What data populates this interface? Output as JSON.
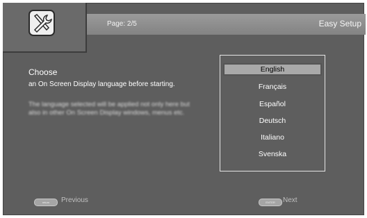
{
  "header": {
    "page_indicator": "Page: 2/5",
    "title": "Easy Setup",
    "icon": "wrench-tool-icon"
  },
  "main": {
    "heading": "Choose",
    "description": "an On Screen Display language before starting.",
    "note": "The language selected will be applied not only here but also in other On Screen Display windows, menus etc."
  },
  "languages": {
    "selected_index": 0,
    "items": [
      "English",
      "Français",
      "Español",
      "Deutsch",
      "Italiano",
      "Svenska"
    ]
  },
  "footer": {
    "previous_key": "return",
    "previous_label": "Previous",
    "next_key": "ENTER",
    "next_label": "Next"
  }
}
